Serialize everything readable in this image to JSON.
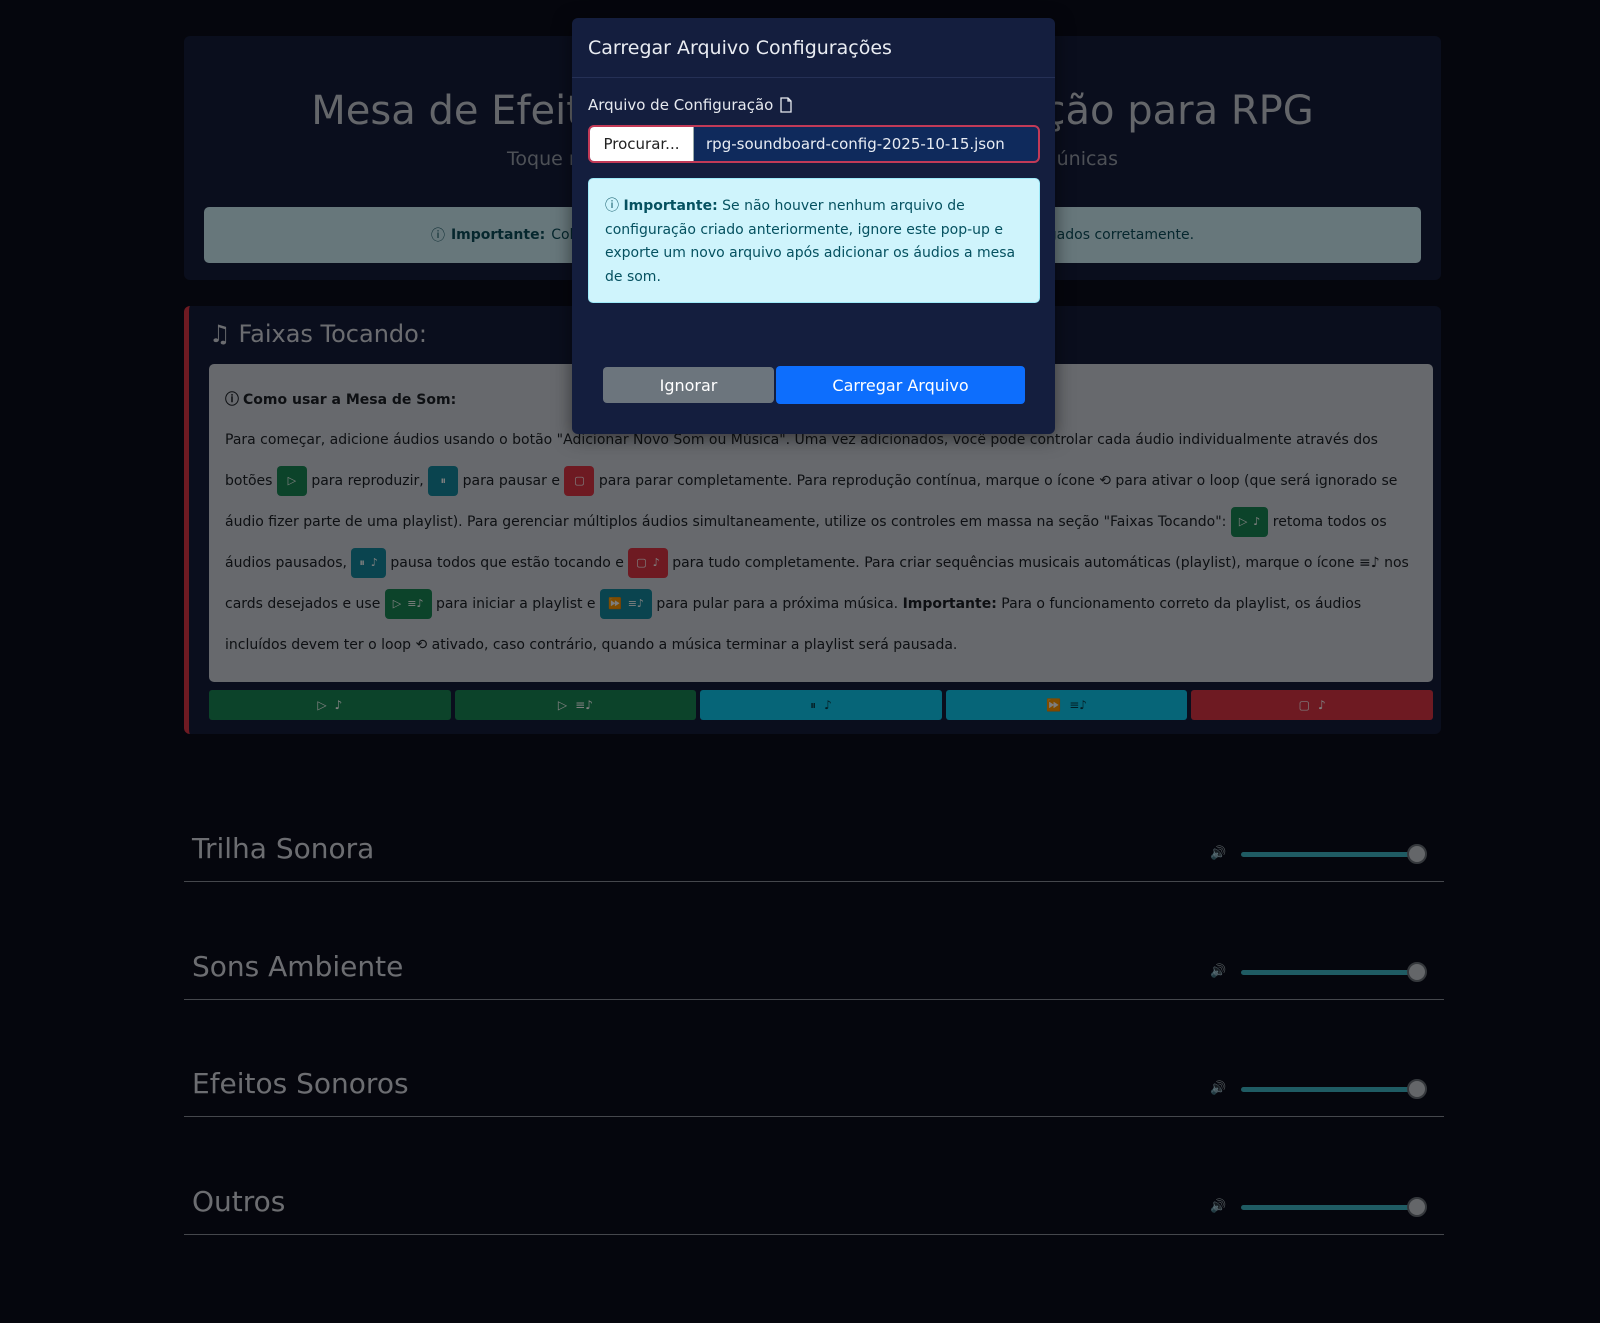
{
  "header": {
    "title": "Mesa de Efeitos Sonoros e Ambientação para RPG",
    "subtitle": "Toque múltiplos sons simultaneamente e crie atmosferas únicas",
    "alert_label": "Importante:",
    "alert_text": "Coloque seus arquivos de áudio na pasta correta para que sejam carregados corretamente."
  },
  "tracks": {
    "title": "Faixas Tocando:",
    "howto_title": "Como usar a Mesa de Som:",
    "howto_t1": "Para começar, adicione áudios usando o botão \"Adicionar Novo Som ou Música\". Uma vez adicionados, você pode controlar cada áudio individualmente através dos botões",
    "howto_t2": "para reproduzir,",
    "howto_t3": "para pausar e",
    "howto_t4": "para parar completamente. Para reprodução contínua, marque o ícone",
    "howto_t5": "para ativar o loop (que será ignorado se áudio fizer parte de uma playlist). Para gerenciar múltiplos áudios simultaneamente, utilize os controles em massa na seção \"Faixas Tocando\":",
    "howto_t6": "retoma todos os áudios pausados,",
    "howto_t7": "pausa todos que estão tocando e",
    "howto_t8": "para tudo completamente. Para criar sequências musicais automáticas (playlist), marque o ícone",
    "howto_t9": "nos cards desejados e use",
    "howto_t10": "para iniciar a playlist e",
    "howto_t11": "para pular para a próxima música.",
    "howto_t12": "Importante:",
    "howto_t13": "Para o funcionamento correto da playlist, os áudios incluídos devem ter o loop",
    "howto_t14": "ativado, caso contrário, quando a música terminar a playlist será pausada."
  },
  "sections": [
    {
      "title": "Trilha Sonora",
      "volume": 1.0
    },
    {
      "title": "Sons Ambiente",
      "volume": 1.0
    },
    {
      "title": "Efeitos Sonoros",
      "volume": 1.0
    },
    {
      "title": "Outros",
      "volume": 1.0
    }
  ],
  "modal": {
    "title": "Carregar Arquivo Configurações",
    "field_label": "Arquivo de Configuração",
    "browse_label": "Procurar...",
    "file_name": "rpg-soundboard-config-2025-10-15.json",
    "alert_label": "Importante:",
    "alert_text": "Se não houver nenhum arquivo de configuração criado anteriormente, ignore este pop-up e exporte um novo arquivo após adicionar os áudios a mesa de som.",
    "ignore_label": "Ignorar",
    "load_label": "Carregar Arquivo"
  },
  "colors": {
    "background": "#0b0d1a",
    "primary": "#0d6efd",
    "secondary": "#6c757d",
    "success": "#198754",
    "info": "#0dcaf0",
    "danger": "#dc3545"
  },
  "icons": [
    "info-icon",
    "music-note-icon",
    "play-icon",
    "pause-icon",
    "stop-icon",
    "loop-icon",
    "playlist-icon",
    "next-icon",
    "volume-icon",
    "json-file-icon"
  ]
}
